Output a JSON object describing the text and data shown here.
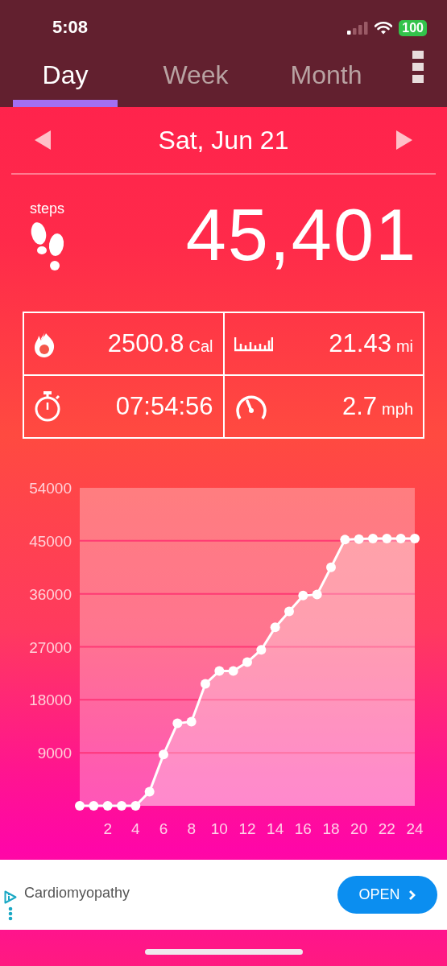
{
  "status_bar": {
    "time": "5:08",
    "battery": "100"
  },
  "tabs": [
    {
      "label": "Day",
      "selected": true
    },
    {
      "label": "Week",
      "selected": false
    },
    {
      "label": "Month",
      "selected": false
    }
  ],
  "date": "Sat, Jun 21",
  "steps": {
    "label": "steps",
    "value": "45,401"
  },
  "metrics": [
    {
      "kind": "calories",
      "value": "2500.8",
      "unit": "Cal"
    },
    {
      "kind": "distance",
      "value": "21.43",
      "unit": "mi"
    },
    {
      "kind": "duration",
      "value": "07:54:56"
    },
    {
      "kind": "speed",
      "value": "2.7",
      "unit": "mph"
    }
  ],
  "chart_data": {
    "type": "area",
    "x": [
      0,
      1,
      2,
      3,
      4,
      5,
      6,
      7,
      8,
      9,
      10,
      11,
      12,
      13,
      14,
      15,
      16,
      17,
      18,
      19,
      20,
      21,
      22,
      23,
      24
    ],
    "series": [
      {
        "color": "#ffffff",
        "values": [
          0,
          0,
          0,
          0,
          0,
          2400,
          8700,
          14000,
          14300,
          20700,
          22900,
          22900,
          24400,
          26500,
          30300,
          33000,
          35700,
          35900,
          40500,
          45200,
          45300,
          45400,
          45400,
          45400,
          45400
        ]
      }
    ],
    "grid": true,
    "xlim": [
      0,
      24
    ],
    "ylim": [
      0,
      54000
    ],
    "xticks": [
      2,
      4,
      6,
      8,
      10,
      12,
      14,
      16,
      18,
      20,
      22,
      24
    ],
    "yticks": [
      9000,
      18000,
      27000,
      36000,
      45000,
      54000
    ]
  },
  "ad": {
    "text": "Cardiomyopathy",
    "button": "OPEN"
  }
}
